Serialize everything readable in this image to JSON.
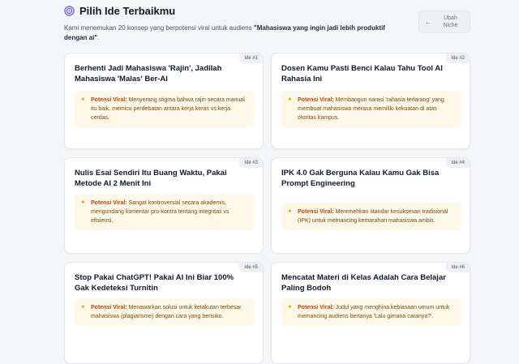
{
  "header": {
    "title": "Pilih Ide Terbaikmu",
    "subtitle_prefix": "Kami menemukan 20 konsep yang berpotensi viral untuk audiens ",
    "subtitle_audience": "\"Mahasiswa yang ingin jadi lebih produktif dengan ai\"",
    "subtitle_suffix": "."
  },
  "back_button": {
    "label": "Ubah Niche",
    "icon": "arrow-left-icon"
  },
  "potential_label": "Potensi Viral:",
  "ideas": [
    {
      "badge": "Ide #1",
      "title": "Berhenti Jadi Mahasiswa 'Rajin', Jadilah Mahasiswa 'Malas' Ber-AI",
      "potential": "Menyerang stigma bahwa rajin secara manual itu baik, memicu perdebatan antara kerja keras vs kerja cerdas."
    },
    {
      "badge": "Ide #2",
      "title": "Dosen Kamu Pasti Benci Kalau Tahu Tool AI Rahasia Ini",
      "potential": "Membangun narasi 'rahasia terlarang' yang membuat mahasiswa merasa memiliki kekuatan di atas otoritas kampus."
    },
    {
      "badge": "Ide #3",
      "title": "Nulis Esai Sendiri Itu Buang Waktu, Pakai Metode AI 2 Menit Ini",
      "potential": "Sangat kontroversial secara akademis, mengundang komentar pro-kontra tentang integritas vs efisiensi."
    },
    {
      "badge": "Ide #4",
      "title": "IPK 4.0 Gak Berguna Kalau Kamu Gak Bisa Prompt Engineering",
      "potential": "Meremehkan standar kesuksesan tradisional (IPK) untuk memancing kemarahan mahasiswa ambis."
    },
    {
      "badge": "Ide #5",
      "title": "Stop Pakai ChatGPT! Pakai AI Ini Biar 100% Gak Kedeteksi Turnitin",
      "potential": "Menawarkan solusi untuk ketakutan terbesar mahasiswa (plagiarisme) dengan cara yang berisiko."
    },
    {
      "badge": "Ide #6",
      "title": "Mencatat Materi di Kelas Adalah Cara Belajar Paling Bodoh",
      "potential": "Judul yang menghina kebiasaan umum untuk memancing audiens bertanya 'Lalu gimana caranya?'."
    }
  ]
}
